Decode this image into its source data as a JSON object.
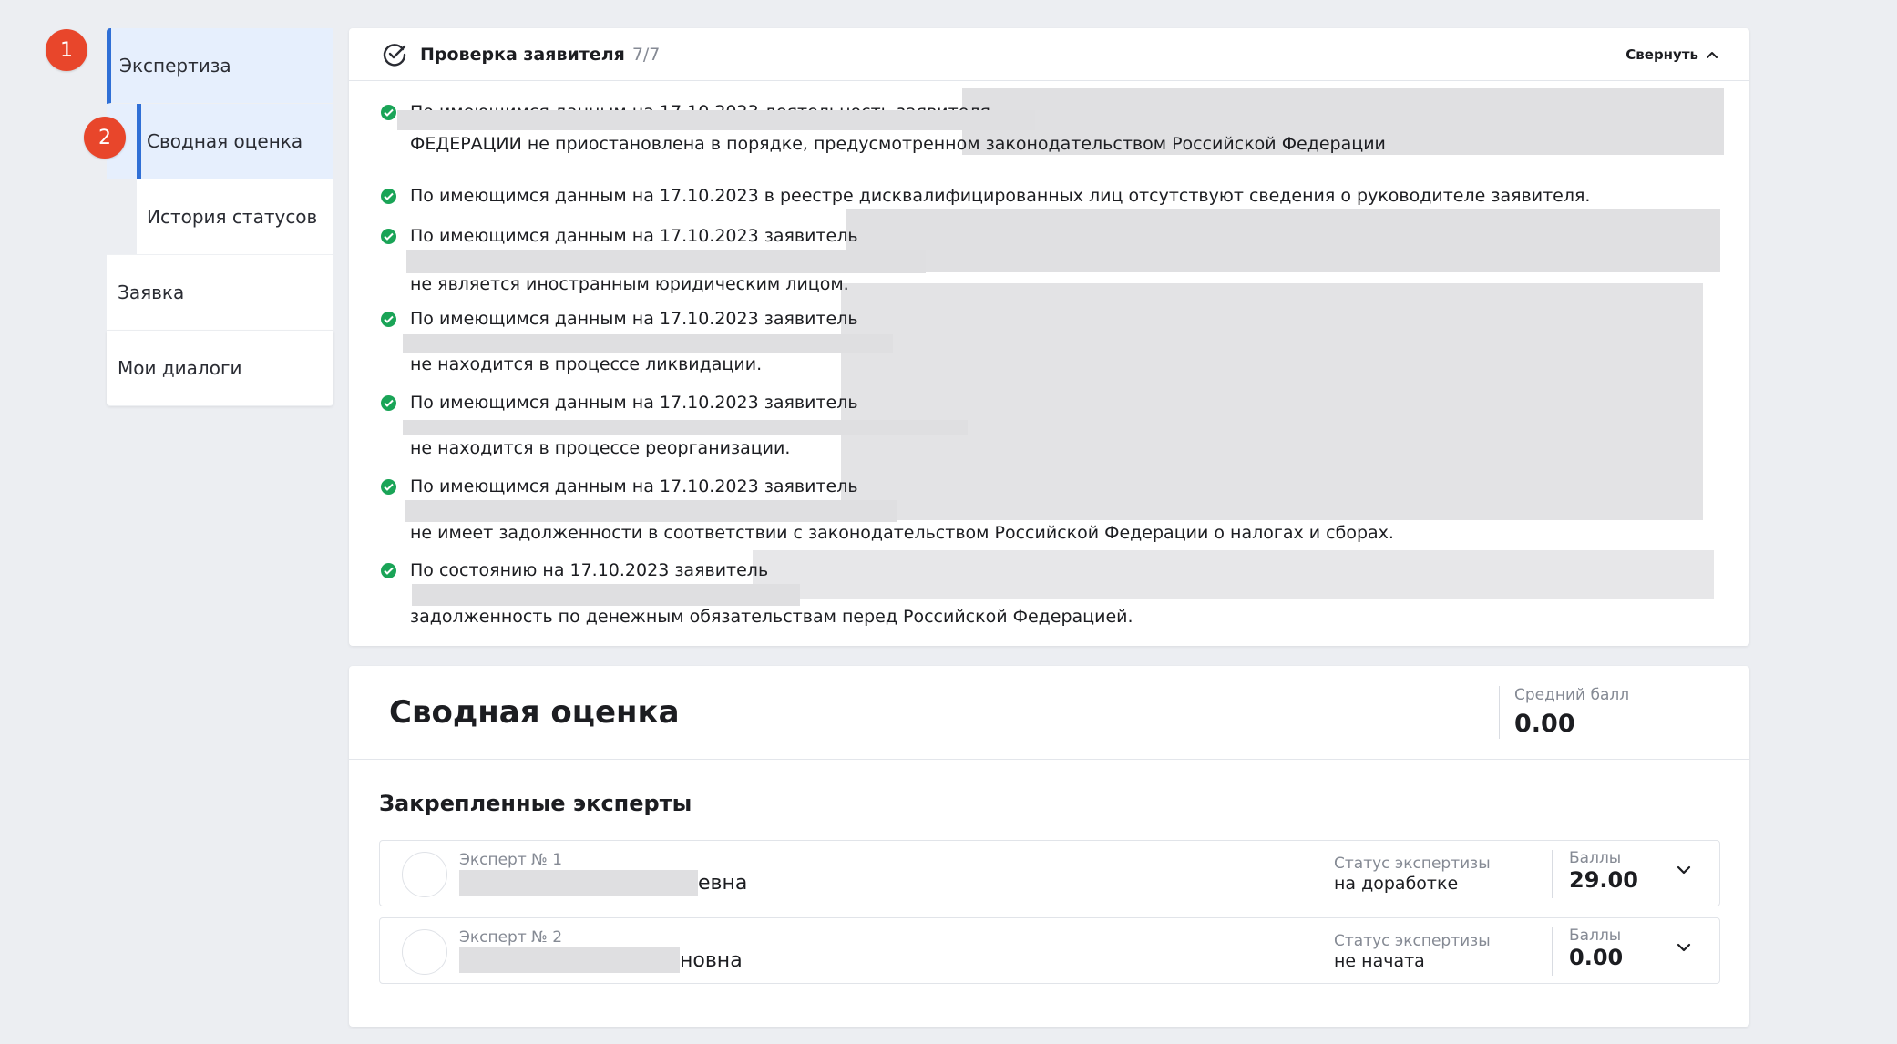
{
  "sidebar": {
    "items": [
      {
        "label": "Экспертиза",
        "badge": "1"
      },
      {
        "label": "Сводная оценка",
        "badge": "2"
      },
      {
        "label": "История статусов"
      },
      {
        "label": "Заявка"
      },
      {
        "label": "Мои диалоги"
      }
    ]
  },
  "check": {
    "title": "Проверка заявителя",
    "count": "7/7",
    "collapse_label": "Свернуть",
    "items": [
      {
        "line1": "По имеющимся данным на 17.10.2023 деятельность заявителя",
        "line2": "ФЕДЕРАЦИИ не приостановлена в порядке, предусмотренном законодательством Российской Федерации"
      },
      {
        "line1": "По имеющимся данным на 17.10.2023 в реестре дисквалифицированных лиц отсутствуют сведения о руководителе заявителя."
      },
      {
        "line1": "По имеющимся данным на 17.10.2023 заявитель",
        "line2": "не является иностранным юридическим лицом."
      },
      {
        "line1": "По имеющимся данным на 17.10.2023 заявитель",
        "line2": "не находится в процессе ликвидации."
      },
      {
        "line1": "По имеющимся данным на 17.10.2023 заявитель",
        "line2": "не находится в процессе реорганизации."
      },
      {
        "line1": "По имеющимся данным на 17.10.2023 заявитель",
        "line2": "не имеет задолженности в соответствии с законодательством Российской Федерации о налогах и сборах."
      },
      {
        "line1": "По состоянию на 17.10.2023 заявитель",
        "line2": "задолженность по денежным обязательствам перед Российской Федерацией."
      }
    ]
  },
  "summary": {
    "title": "Сводная оценка",
    "avg_label": "Средний балл",
    "avg_value": "0.00",
    "experts_title": "Закрепленные эксперты",
    "experts": [
      {
        "number": "Эксперт № 1",
        "name_suffix": "евна",
        "status_label": "Статус экспертизы",
        "status": "на доработке",
        "score_label": "Баллы",
        "score": "29.00"
      },
      {
        "number": "Эксперт № 2",
        "name_suffix": "новна",
        "status_label": "Статус экспертизы",
        "status": "не начата",
        "score_label": "Баллы",
        "score": "0.00"
      }
    ]
  },
  "icons": {
    "check_title": "list-check-icon",
    "collapse": "chevron-up-icon",
    "status_ok": "check-circle-icon",
    "expand": "chevron-down-icon"
  },
  "colors": {
    "accent": "#2f6fd6",
    "badge": "#e8462b",
    "ok": "#1aa457",
    "active_bg": "#e6effd"
  }
}
